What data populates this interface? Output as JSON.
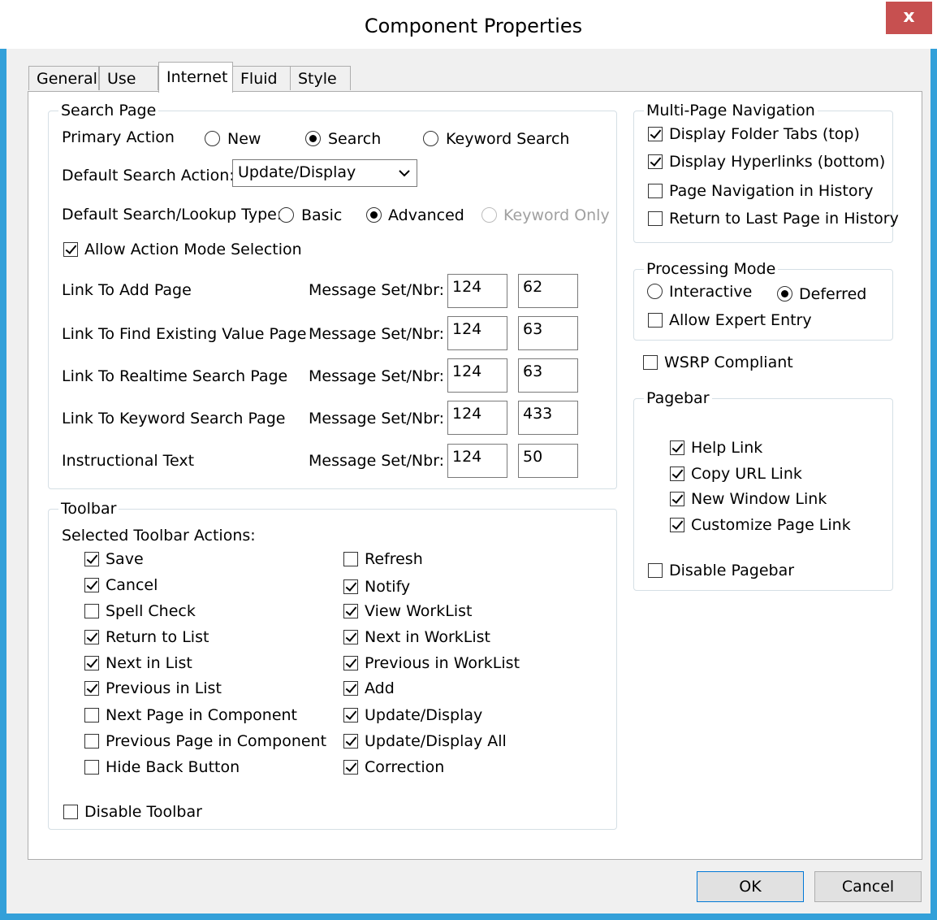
{
  "window": {
    "title": "Component Properties",
    "close_label": "x"
  },
  "tabs": [
    "General",
    "Use",
    "Internet",
    "Fluid",
    "Style"
  ],
  "search_page": {
    "title": "Search Page",
    "primary_action_label": "Primary Action",
    "primary_options": [
      "New",
      "Search",
      "Keyword Search"
    ],
    "default_search_action_label": "Default Search Action:",
    "default_search_action_value": "Update/Display",
    "lookup_type_label": "Default Search/Lookup Type:",
    "lookup_options": [
      "Basic",
      "Advanced",
      "Keyword Only"
    ],
    "allow_action_mode": "Allow Action Mode Selection",
    "msg_label": "Message Set/Nbr:",
    "links": [
      {
        "label": "Link To Add Page",
        "set": "124",
        "nbr": "62"
      },
      {
        "label": "Link To Find Existing Value Page",
        "set": "124",
        "nbr": "63"
      },
      {
        "label": "Link To Realtime Search Page",
        "set": "124",
        "nbr": "63"
      },
      {
        "label": "Link To Keyword Search Page",
        "set": "124",
        "nbr": "433"
      },
      {
        "label": "Instructional Text",
        "set": "124",
        "nbr": "50"
      }
    ]
  },
  "toolbar": {
    "title": "Toolbar",
    "selected_label": "Selected Toolbar Actions:",
    "left": [
      "Save",
      "Cancel",
      "Spell Check",
      "Return to List",
      "Next in List",
      "Previous in List",
      "Next Page in Component",
      "Previous Page in Component",
      "Hide Back Button"
    ],
    "right": [
      "Refresh",
      "Notify",
      "View WorkList",
      "Next in WorkList",
      "Previous in WorkList",
      "Add",
      "Update/Display",
      "Update/Display All",
      "Correction"
    ],
    "disable": "Disable Toolbar"
  },
  "multipage": {
    "title": "Multi-Page Navigation",
    "items": [
      "Display Folder Tabs (top)",
      "Display Hyperlinks (bottom)",
      "Page Navigation in History",
      "Return to Last Page in History"
    ]
  },
  "processing": {
    "title": "Processing Mode",
    "interactive": "Interactive",
    "deferred": "Deferred",
    "expert": "Allow Expert Entry"
  },
  "wsrp": "WSRP Compliant",
  "pagebar": {
    "title": "Pagebar",
    "items": [
      "Help Link",
      "Copy URL Link",
      "New Window Link",
      "Customize Page Link"
    ],
    "disable": "Disable Pagebar"
  },
  "buttons": {
    "ok": "OK",
    "cancel": "Cancel"
  }
}
